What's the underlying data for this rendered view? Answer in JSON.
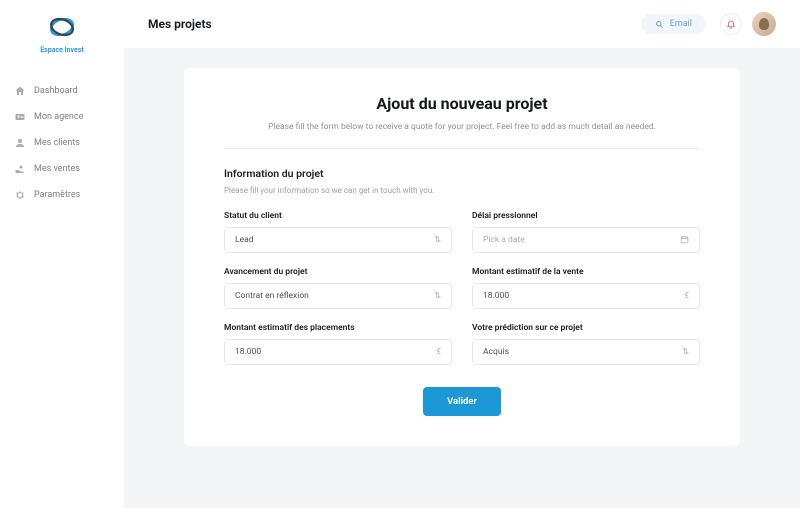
{
  "brand": {
    "name": "Espace Invest"
  },
  "sidebar": {
    "items": [
      {
        "label": "Dashboard"
      },
      {
        "label": "Mon agence"
      },
      {
        "label": "Mes clients"
      },
      {
        "label": "Mes ventes"
      },
      {
        "label": "Paramètres"
      }
    ]
  },
  "header": {
    "page_title": "Mes projets",
    "search_placeholder": "Email"
  },
  "card": {
    "title": "Ajout du nouveau projet",
    "subtitle": "Please fill the form below to receive a quote for your project. Feel free to add as much detail as needed.",
    "section_title": "Information du projet",
    "section_desc": "Please fill your information so we can get in touch with you."
  },
  "form": {
    "fields": [
      {
        "label": "Statut du client",
        "value": "Lead",
        "kind": "select"
      },
      {
        "label": "Délai pressionnel",
        "value": "Pick a date",
        "kind": "date",
        "is_placeholder": true
      },
      {
        "label": "Avancement du projet",
        "value": "Contrat en réflexion",
        "kind": "select"
      },
      {
        "label": "Montant estimatif de la vente",
        "value": "18.000",
        "kind": "currency"
      },
      {
        "label": "Montant estimatif des placements",
        "value": "18.000",
        "kind": "currency"
      },
      {
        "label": "Votre prédiction sur ce projet",
        "value": "Acquis",
        "kind": "select"
      }
    ],
    "submit_label": "Valider"
  }
}
